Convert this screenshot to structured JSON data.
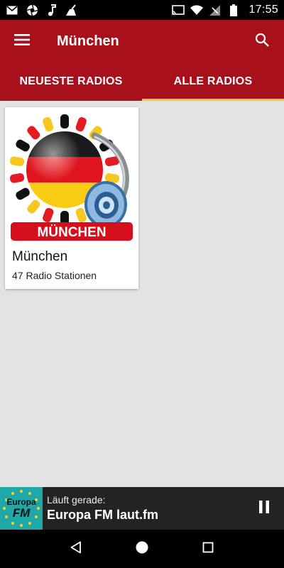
{
  "status_bar": {
    "time": "17:55",
    "icons": [
      "mail-icon",
      "aperture-icon",
      "music-note-icon",
      "broom-icon",
      "cast-icon",
      "wifi-icon",
      "no-sim-icon",
      "battery-icon"
    ]
  },
  "appbar": {
    "title": "München",
    "menu_icon": "hamburger-menu-icon",
    "search_icon": "search-icon",
    "color": "#a8101b"
  },
  "tabs": [
    {
      "label": "NEUESTE RADIOS",
      "active": false
    },
    {
      "label": "ALLE RADIOS",
      "active": true
    }
  ],
  "tab_indicator_color": "#f4c63d",
  "cards": [
    {
      "title": "München",
      "subtitle": "47 Radio Stationen",
      "image_banner": "MÜNCHEN"
    }
  ],
  "player": {
    "playing_label": "Läuft gerade:",
    "station": "Europa FM laut.fm",
    "logo_text_1": "Europa",
    "logo_text_2": "FM",
    "control_icon": "pause-icon"
  },
  "nav": {
    "back_icon": "back-triangle-icon",
    "home_icon": "home-circle-icon",
    "recents_icon": "recents-square-icon"
  }
}
